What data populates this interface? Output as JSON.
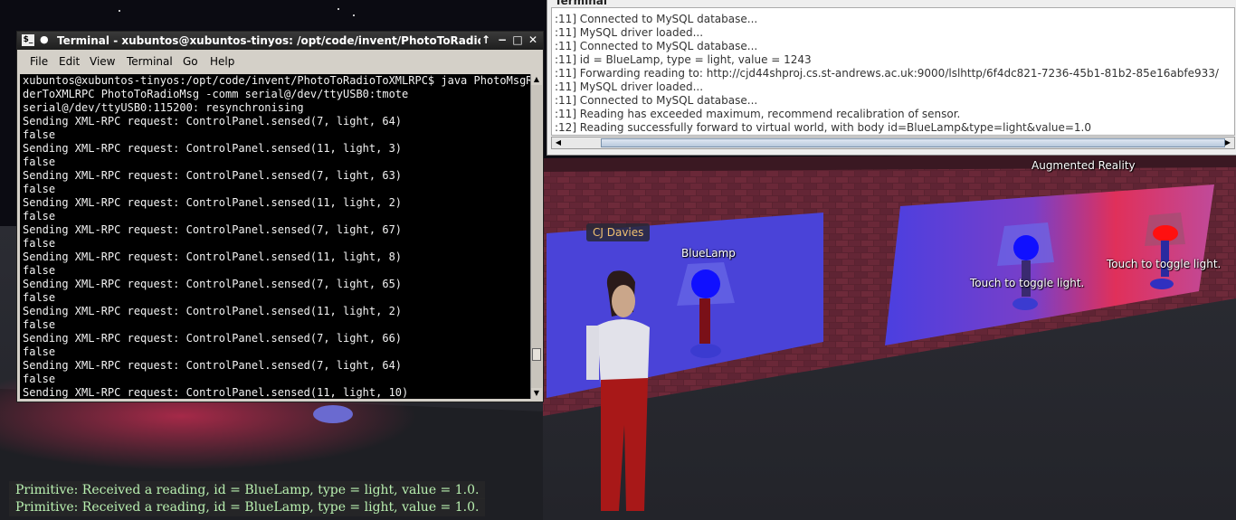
{
  "scene": {
    "avatar_name": "CJ Davies",
    "blue_lamp_label": "BlueLamp",
    "ar_label": "Augmented Reality",
    "touch_label_1": "Touch to toggle light.",
    "touch_label_2": "Touch to toggle light."
  },
  "chat": [
    "Primitive: Received a reading, id = BlueLamp, type = light, value = 1.0.",
    "Primitive: Received a reading, id = BlueLamp, type = light, value = 1.0."
  ],
  "terminal": {
    "title": "Terminal - xubuntos@xubuntos-tinyos: /opt/code/invent/PhotoToRadioTo",
    "app_icon": "terminal-icon",
    "menu": {
      "file": "File",
      "edit": "Edit",
      "view": "View",
      "terminal": "Terminal",
      "go": "Go",
      "help": "Help"
    },
    "lines": [
      "xubuntos@xubuntos-tinyos:/opt/code/invent/PhotoToRadioToXMLRPC$ java PhotoMsgRea",
      "derToXMLRPC PhotoToRadioMsg -comm serial@/dev/ttyUSB0:tmote",
      "serial@/dev/ttyUSB0:115200: resynchronising",
      "Sending XML-RPC request: ControlPanel.sensed(7, light, 64)",
      "false",
      "Sending XML-RPC request: ControlPanel.sensed(11, light, 3)",
      "false",
      "Sending XML-RPC request: ControlPanel.sensed(7, light, 63)",
      "false",
      "Sending XML-RPC request: ControlPanel.sensed(11, light, 2)",
      "false",
      "Sending XML-RPC request: ControlPanel.sensed(7, light, 67)",
      "false",
      "Sending XML-RPC request: ControlPanel.sensed(11, light, 8)",
      "false",
      "Sending XML-RPC request: ControlPanel.sensed(7, light, 65)",
      "false",
      "Sending XML-RPC request: ControlPanel.sensed(11, light, 2)",
      "false",
      "Sending XML-RPC request: ControlPanel.sensed(7, light, 66)",
      "false",
      "Sending XML-RPC request: ControlPanel.sensed(7, light, 64)",
      "false",
      "Sending XML-RPC request: ControlPanel.sensed(11, light, 10)"
    ]
  },
  "log": {
    "title": "Terminal",
    "lines": [
      ":11] Connected to MySQL database...",
      ":11] MySQL driver loaded...",
      ":11] Connected to MySQL database...",
      ":11] id = BlueLamp, type = light, value = 1243",
      ":11] Forwarding reading to: http://cjd44shproj.cs.st-andrews.ac.uk:9000/lslhttp/6f4dc821-7236-45b1-81b2-85e16abfe933/",
      ":11] MySQL driver loaded...",
      ":11] Connected to MySQL database...",
      ":11] Reading has exceeded maximum, recommend recalibration of sensor.",
      ":12] Reading successfully forward to virtual world, with body id=BlueLamp&type=light&value=1.0"
    ]
  },
  "colors": {
    "chat_text": "#b9f0b0",
    "terminal_bg": "#000000",
    "terminal_fg": "#f2f2f2",
    "avatar_name": "#f0c070"
  }
}
